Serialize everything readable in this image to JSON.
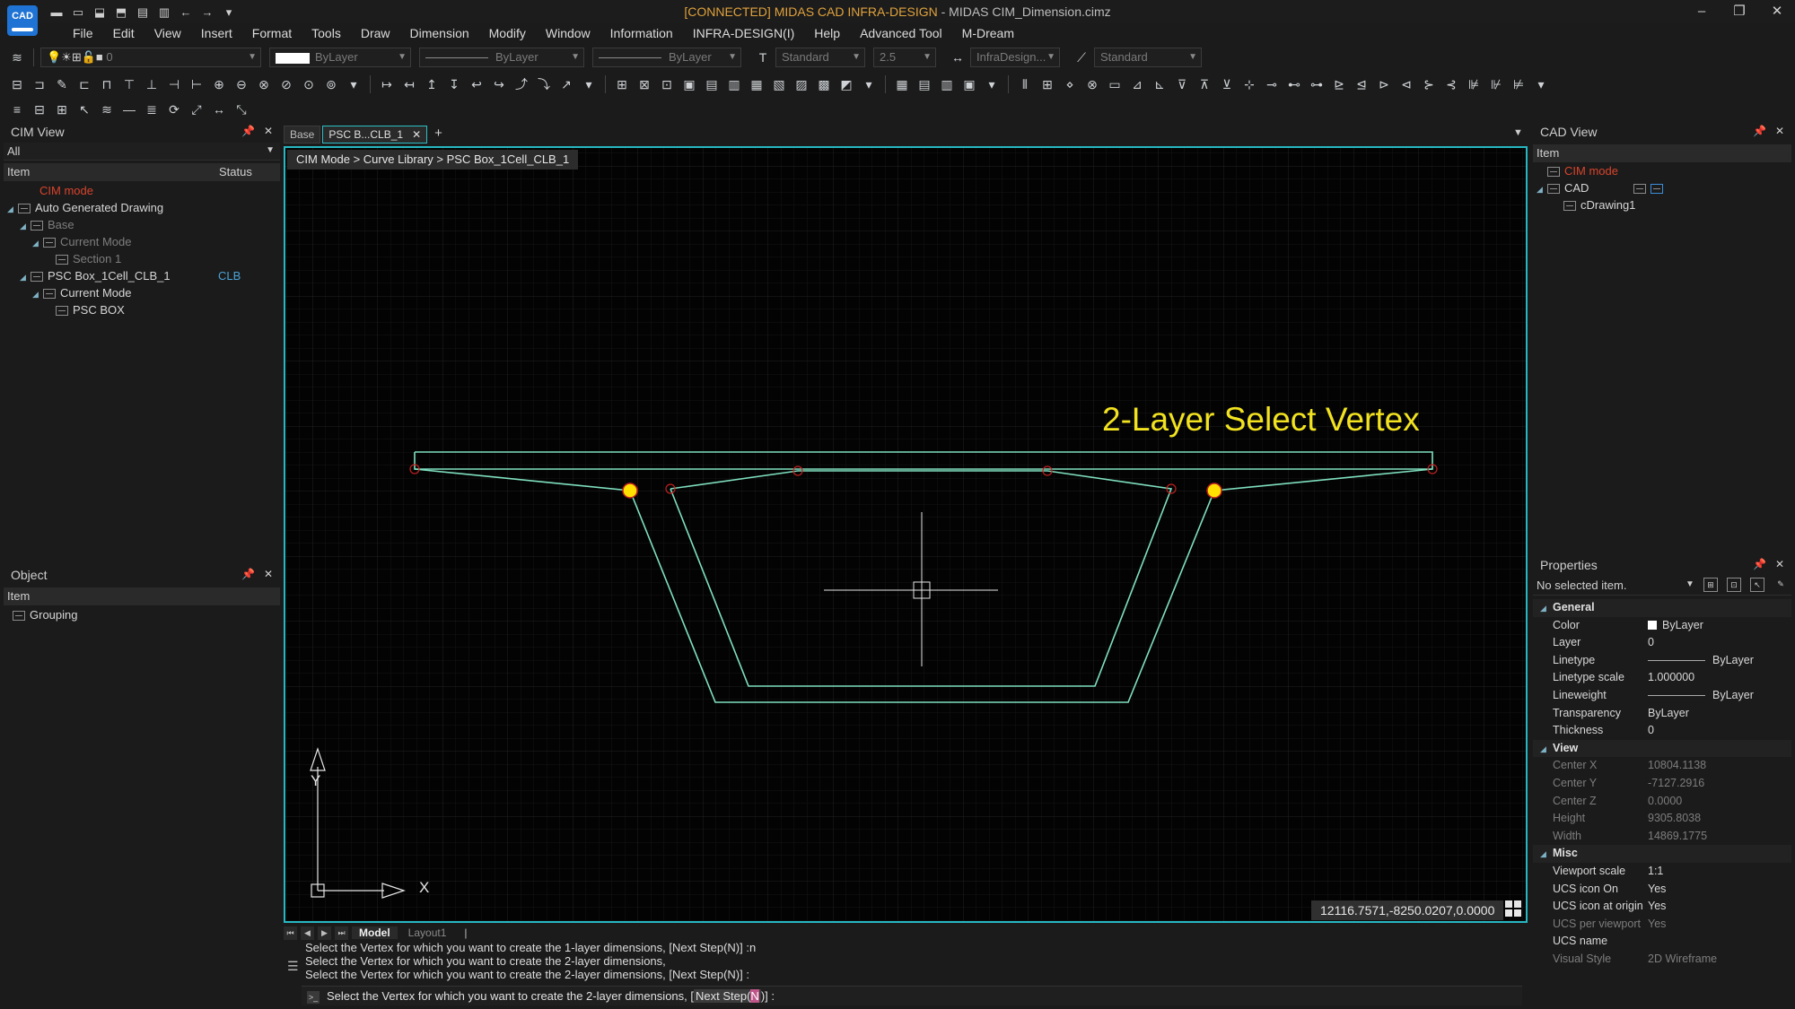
{
  "window": {
    "logo_text": "CAD",
    "title_connected": "[CONNECTED] MIDAS CAD INFRA-DESIGN",
    "title_rest": " - MIDAS CIM_Dimension.cimz",
    "controls": [
      "–",
      "❐",
      "✕"
    ]
  },
  "menu": [
    "File",
    "Edit",
    "View",
    "Insert",
    "Format",
    "Tools",
    "Draw",
    "Dimension",
    "Modify",
    "Window",
    "Information",
    "INFRA-DESIGN(I)",
    "Help",
    "Advanced Tool",
    "M-Dream"
  ],
  "toolbar": {
    "layer_value": "0",
    "color_value": "ByLayer",
    "linetype_value": "ByLayer",
    "lineweight_value": "ByLayer",
    "text_style": "Standard",
    "text_height": "2.5",
    "dim_style": "InfraDesign...",
    "table_style": "Standard"
  },
  "cim_view": {
    "title": "CIM View",
    "filter": "All",
    "col_item": "Item",
    "col_status": "Status",
    "tree": [
      {
        "label": "CIM mode",
        "level": 0,
        "style": "red"
      },
      {
        "label": "Auto Generated Drawing",
        "level": 0,
        "toggle": "◢"
      },
      {
        "label": "Base",
        "level": 1,
        "toggle": "◢",
        "style": "dim"
      },
      {
        "label": "Current Mode",
        "level": 2,
        "toggle": "◢",
        "style": "dim"
      },
      {
        "label": "Section 1",
        "level": 3,
        "style": "dim"
      },
      {
        "label": "PSC Box_1Cell_CLB_1",
        "level": 1,
        "toggle": "◢",
        "status": "CLB"
      },
      {
        "label": "Current Mode",
        "level": 2,
        "toggle": "◢"
      },
      {
        "label": "PSC BOX",
        "level": 3
      }
    ]
  },
  "object_panel": {
    "title": "Object",
    "col_item": "Item",
    "items": [
      "Grouping"
    ]
  },
  "tabs": {
    "items": [
      {
        "label": "Base",
        "active": false
      },
      {
        "label": "PSC B...CLB_1",
        "active": true
      }
    ],
    "plus": "+"
  },
  "viewport": {
    "breadcrumb": "CIM Mode > Curve Library > PSC Box_1Cell_CLB_1",
    "overlay": "2-Layer Select Vertex",
    "coords": "12116.7571,-8250.0207,0.0000",
    "axis_y": "Y",
    "axis_x": "X"
  },
  "layout_tabs": [
    "Model",
    "Layout1"
  ],
  "command": {
    "history": [
      "Select the Vertex for which you want to create the 1-layer dimensions, [Next Step(N)] :n",
      "Select the Vertex for which you want to create the 2-layer dimensions,",
      "Select the Vertex for which you want to create the 2-layer dimensions, [Next Step(N)] :"
    ],
    "prompt_before": "Select the Vertex for which you want to create the 2-layer dimensions, [",
    "prompt_option": "Next Step(",
    "prompt_hotkey": "N",
    "prompt_after": ")] :"
  },
  "cad_view": {
    "title": "CAD View",
    "col_item": "Item",
    "tree": [
      {
        "label": "CIM mode",
        "style": "red",
        "level": 0
      },
      {
        "label": "CAD",
        "level": 0,
        "toggle": "◢"
      },
      {
        "label": "cDrawing1",
        "level": 1
      }
    ]
  },
  "properties": {
    "title": "Properties",
    "selection": "No selected item.",
    "sections": [
      {
        "name": "General",
        "rows": [
          {
            "key": "Color",
            "value": "ByLayer",
            "swatch": true
          },
          {
            "key": "Layer",
            "value": "0"
          },
          {
            "key": "Linetype",
            "value": "ByLayer",
            "line": true
          },
          {
            "key": "Linetype scale",
            "value": "1.000000"
          },
          {
            "key": "Lineweight",
            "value": "ByLayer",
            "line": true
          },
          {
            "key": "Transparency",
            "value": "ByLayer"
          },
          {
            "key": "Thickness",
            "value": "0"
          }
        ]
      },
      {
        "name": "View",
        "rows": [
          {
            "key": "Center X",
            "value": "10804.1138",
            "ro": true
          },
          {
            "key": "Center Y",
            "value": "-7127.2916",
            "ro": true
          },
          {
            "key": "Center Z",
            "value": "0.0000",
            "ro": true
          },
          {
            "key": "Height",
            "value": "9305.8038",
            "ro": true
          },
          {
            "key": "Width",
            "value": "14869.1775",
            "ro": true
          }
        ]
      },
      {
        "name": "Misc",
        "rows": [
          {
            "key": "Viewport scale",
            "value": "1:1"
          },
          {
            "key": "UCS icon On",
            "value": "Yes"
          },
          {
            "key": "UCS icon at origin",
            "value": "Yes"
          },
          {
            "key": "UCS per viewport",
            "value": "Yes",
            "ro": true
          },
          {
            "key": "UCS name",
            "value": ""
          },
          {
            "key": "Visual Style",
            "value": "2D Wireframe",
            "ro": true
          }
        ]
      }
    ]
  },
  "colors": {
    "accent": "#27b7c2",
    "geometry": "#7fe0c0",
    "vertex_selected": "#ffe000",
    "vertex_marker": "#c02020",
    "overlay_text": "#f2e21f",
    "cim_mode_red": "#d9442c"
  }
}
